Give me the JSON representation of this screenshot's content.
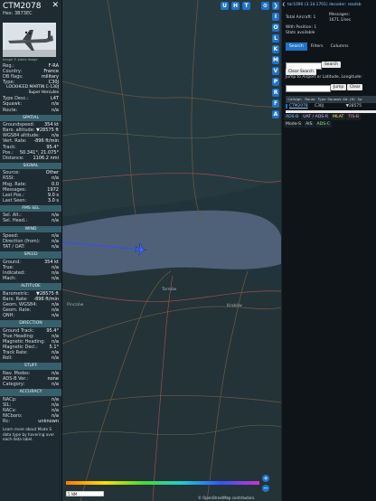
{
  "left": {
    "callsign": "CTM2078",
    "hex_label": "Hex: 3B73EC",
    "photo_credit": "Image © plane-image",
    "reg_rows": [
      {
        "k": "Reg.:",
        "v": "F-RA"
      },
      {
        "k": "Country:",
        "v": "France"
      },
      {
        "k": "DB flags:",
        "v": "military"
      },
      {
        "k": "Type:",
        "v": "C30J"
      }
    ],
    "type_full": "LOCKHEED MARTIN C-130J Super Hercules",
    "type_rows": [
      {
        "k": "Type Desc.:",
        "v": "L4T"
      },
      {
        "k": "Squawk:",
        "v": "n/a"
      },
      {
        "k": "Route:",
        "v": "n/a"
      }
    ],
    "spatial_title": "SPATIAL",
    "spatial_rows": [
      {
        "k": "Groundspeed:",
        "v": "354 kt"
      },
      {
        "k": "Baro. altitude:",
        "v": "▼28575 ft"
      },
      {
        "k": "WGS84 altitude:",
        "v": "n/a"
      },
      {
        "k": "Vert. Rate:",
        "v": "-896 ft/min"
      },
      {
        "k": "Track:",
        "v": "95.4°"
      },
      {
        "k": "Pos.:",
        "v": "50.341°, 21.075°"
      },
      {
        "k": "Distance:",
        "v": "1106.2 nmi"
      }
    ],
    "signal_title": "SIGNAL",
    "signal_rows": [
      {
        "k": "Source:",
        "v": "Other"
      },
      {
        "k": "RSSI:",
        "v": "n/a"
      },
      {
        "k": "Msg. Rate:",
        "v": "0.0"
      },
      {
        "k": "Messages:",
        "v": "1972"
      },
      {
        "k": "Last Pos.:",
        "v": "9.0 s"
      },
      {
        "k": "Last Seen:",
        "v": "3.0 s"
      }
    ],
    "fms_title": "FMS SEL",
    "fms_rows": [
      {
        "k": "Sel. Alt.:",
        "v": "n/a"
      },
      {
        "k": "Sel. Head.:",
        "v": "n/a"
      }
    ],
    "wind_title": "WIND",
    "wind_rows": [
      {
        "k": "Speed:",
        "v": "n/a"
      },
      {
        "k": "Direction (from):",
        "v": "n/a"
      },
      {
        "k": "TAT / OAT:",
        "v": "n/a"
      }
    ],
    "speed_title": "SPEED",
    "speed_rows": [
      {
        "k": "Ground:",
        "v": "354 kt"
      },
      {
        "k": "True:",
        "v": "n/a"
      },
      {
        "k": "Indicated:",
        "v": "n/a"
      },
      {
        "k": "Mach:",
        "v": "n/a"
      }
    ],
    "altitude_title": "ALTITUDE",
    "altitude_rows": [
      {
        "k": "Barometric:",
        "v": "▼28575 ft"
      },
      {
        "k": "Baro. Rate:",
        "v": "-896 ft/min"
      },
      {
        "k": "Geom. WGS84:",
        "v": "n/a"
      },
      {
        "k": "Geom. Rate:",
        "v": "n/a"
      },
      {
        "k": "QNH:",
        "v": "n/a"
      }
    ],
    "direction_title": "DIRECTION",
    "direction_rows": [
      {
        "k": "Ground Track:",
        "v": "95.4°"
      },
      {
        "k": "True Heading:",
        "v": "n/a"
      },
      {
        "k": "Magnetic Heading:",
        "v": "n/a"
      },
      {
        "k": "Magnetic Decl.:",
        "v": "5.1°"
      },
      {
        "k": "Track Rate:",
        "v": "n/a"
      },
      {
        "k": "Roll:",
        "v": "n/a"
      }
    ],
    "stuff_title": "STUFF",
    "stuff_rows": [
      {
        "k": "Nav. Modes:",
        "v": "n/a"
      },
      {
        "k": "ADS-B Ver.:",
        "v": "none"
      },
      {
        "k": "Category:",
        "v": "n/a"
      }
    ],
    "accuracy_title": "ACCURACY",
    "accuracy_rows": [
      {
        "k": "NACp:",
        "v": "n/a"
      },
      {
        "k": "SIL:",
        "v": "n/a"
      },
      {
        "k": "NACv:",
        "v": "n/a"
      },
      {
        "k": "NICbaro:",
        "v": "n/a"
      },
      {
        "k": "Rc:",
        "v": "unknown"
      }
    ],
    "footer_note": "Learn more about Mode S data type by hovering over each data label."
  },
  "map": {
    "top_buttons": [
      "U",
      "H",
      "T"
    ],
    "side_buttons": [
      "I",
      "O",
      "L",
      "K",
      "M",
      "V",
      "P",
      "R",
      "F",
      "A"
    ],
    "scale_label": "5 NM",
    "attribution": "© OpenStreetMap contributors.",
    "town_label": "Tarnów",
    "place_label_1": "Pinczów",
    "place_label_2": "Kraków",
    "zoom_in": "+",
    "zoom_out": "−"
  },
  "right": {
    "version_line": "tar1090 (3.14.1701) decoder: readsb",
    "total_aircraft_label": "Total Aircraft: 1",
    "messages_label": "Messages:",
    "messages_value": "1671.1/sec",
    "with_position": "With Position: 1",
    "stats": "Stats available",
    "tabs": [
      "Search",
      "Filters",
      "Columns"
    ],
    "search_button": "Search",
    "clear_search": "Clear Search",
    "jump_prompt": "Jump to Airport or Latitude, Longitude:",
    "jump_button": "Jump",
    "clear_button": "Clear",
    "table_headers": [
      "Callsign",
      "Route",
      "Type",
      "Squawk",
      "Alt. (ft)",
      "Sp"
    ],
    "table_row": {
      "callsign": "CTM2078",
      "type": "C30J",
      "alt": "▼28575"
    },
    "legend": [
      {
        "label": "ADS-B",
        "color": "#7fbfff"
      },
      {
        "label": "UAT / ADS-R",
        "color": "#d8b4ff"
      },
      {
        "label": "MLAT",
        "color": "#f0e060"
      },
      {
        "label": "TIS-B",
        "color": "#ff9a9a"
      },
      {
        "label": "Mode-S",
        "color": "#cfd8dc"
      },
      {
        "label": "AIS",
        "color": "#cfd8dc"
      },
      {
        "label": "ADS-C",
        "color": "#90e090"
      }
    ]
  }
}
